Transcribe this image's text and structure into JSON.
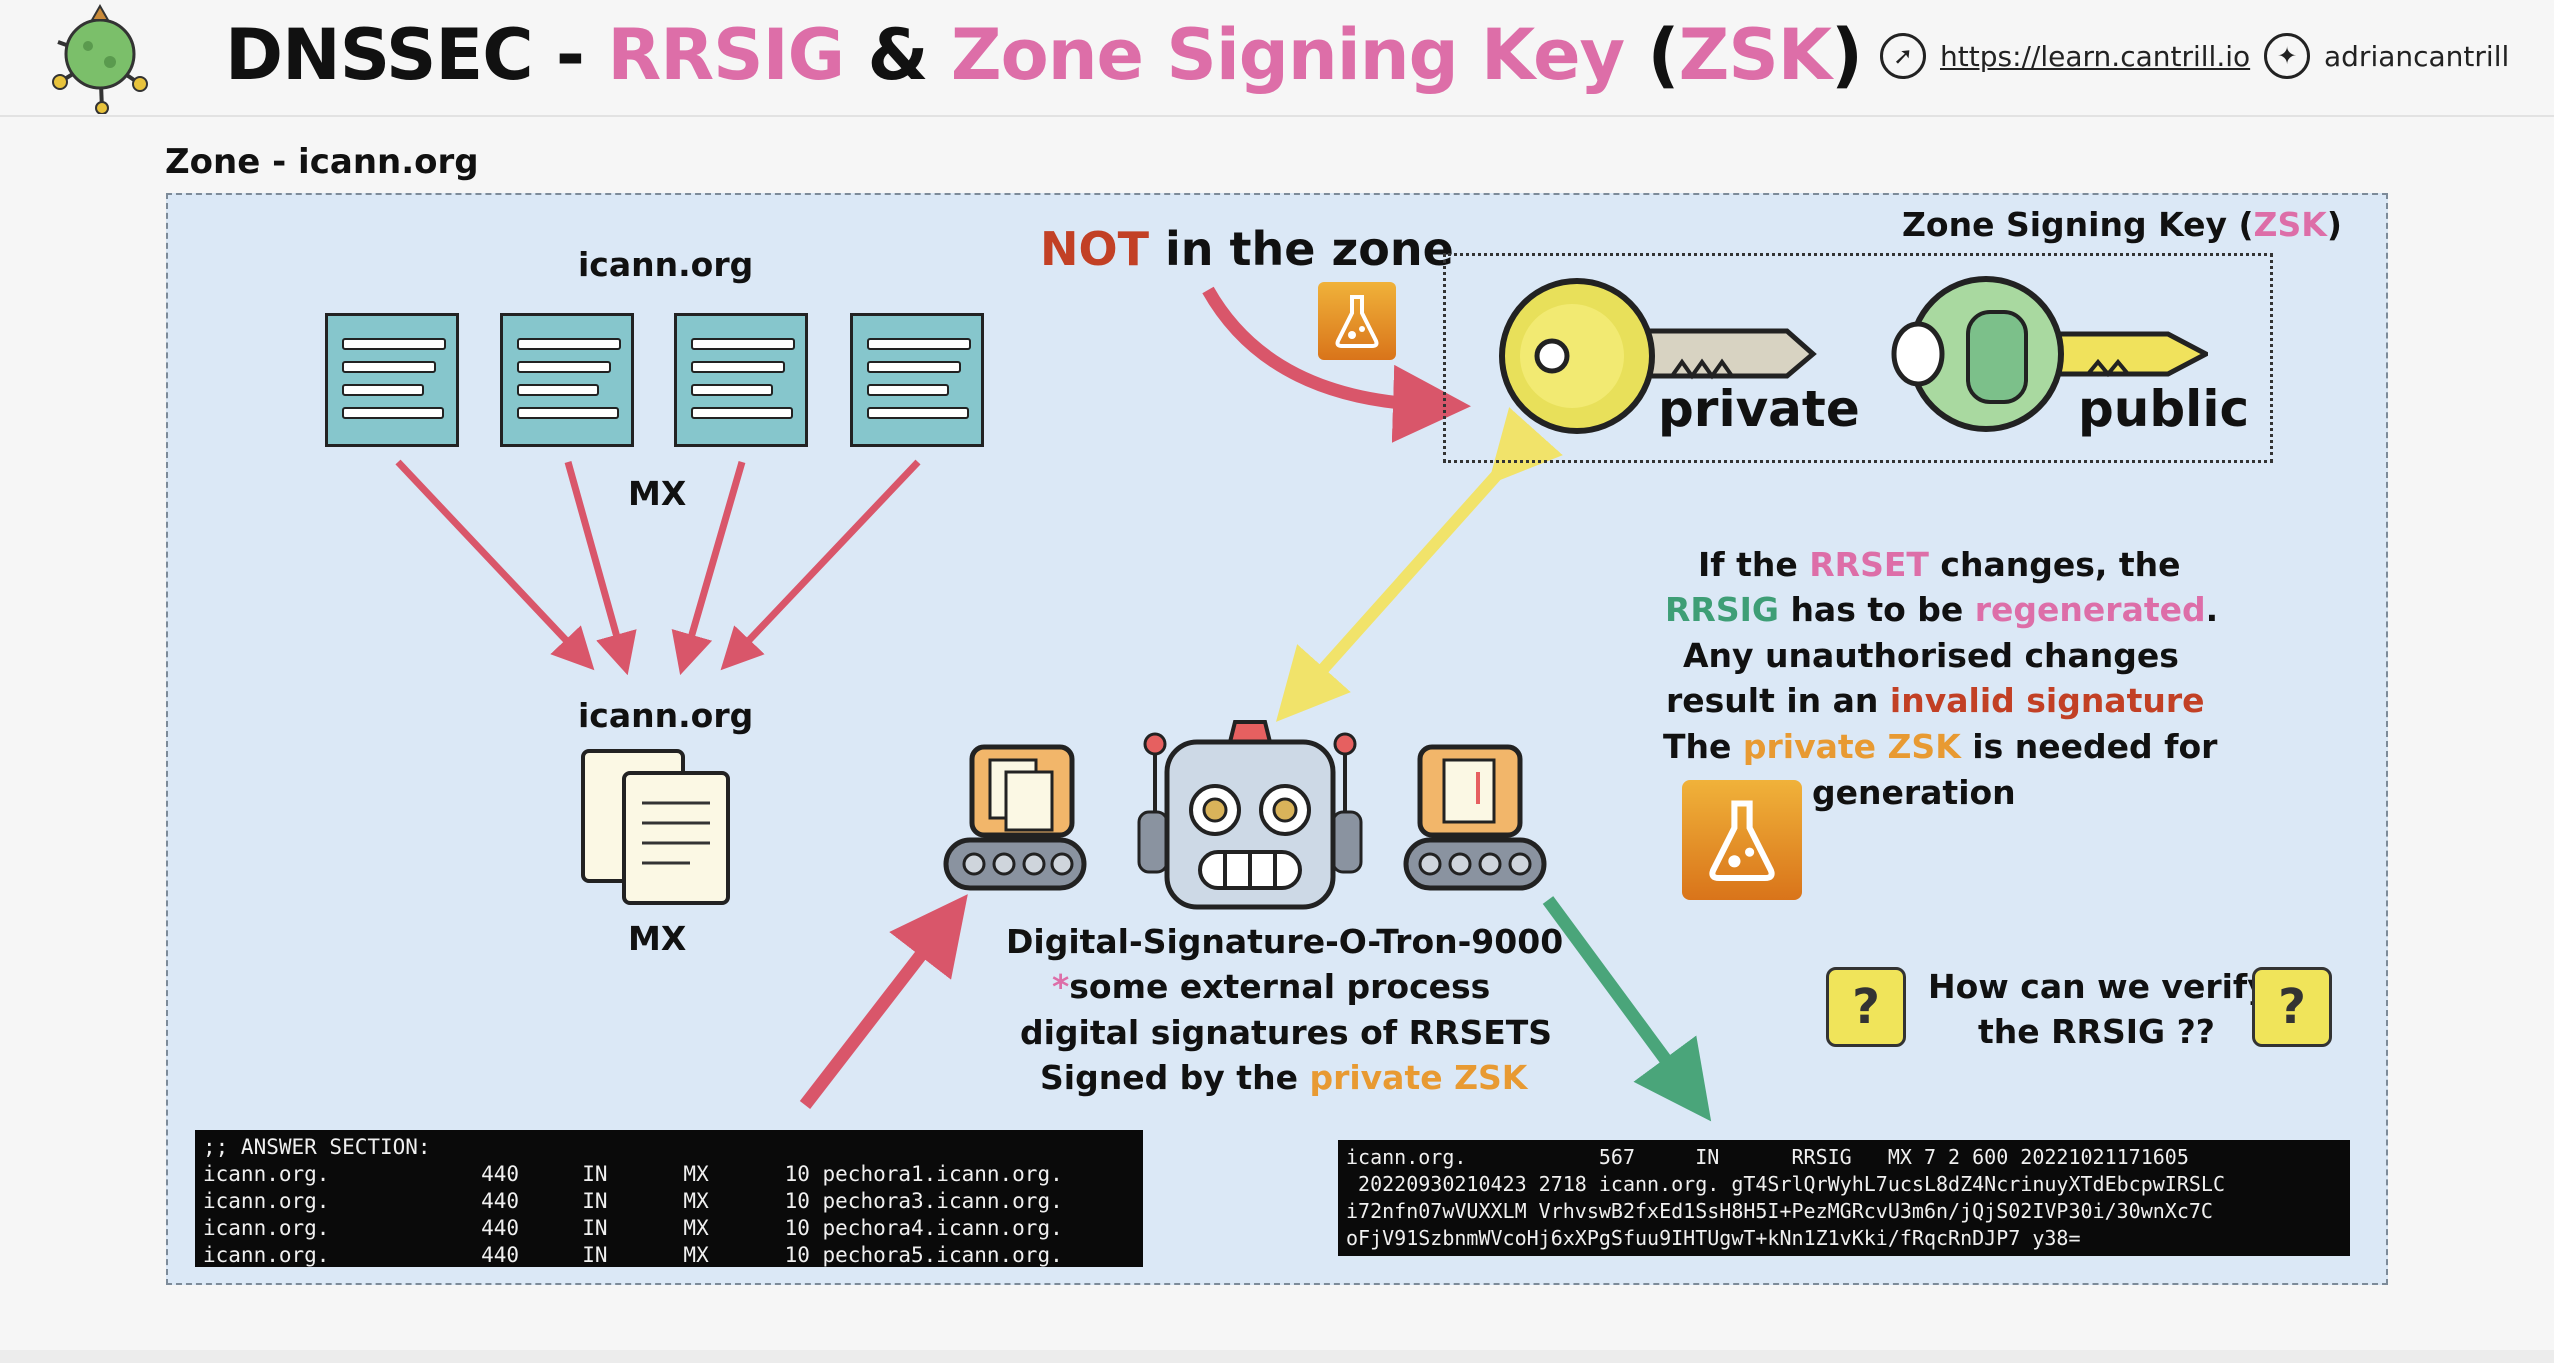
{
  "header": {
    "title_parts": [
      "DNSSEC - ",
      "RRSIG",
      " & ",
      "Zone Signing Key",
      " (",
      "ZSK",
      ")"
    ],
    "link_url": "https://learn.cantrill.io",
    "twitter": "adriancantrill",
    "compass_icon": "compass-icon",
    "twitter_icon": "twitter-bird-icon"
  },
  "zone": {
    "label": "Zone - icann.org",
    "rrset_top_label": "icann.org",
    "rrset_top_type": "MX",
    "rrset_bottom_label": "icann.org",
    "rrset_bottom_type": "MX"
  },
  "zsk": {
    "title_parts": [
      "Zone Signing Key (",
      "ZSK",
      ")"
    ],
    "not_in_zone_parts": [
      "NOT",
      " in the zone"
    ],
    "private_label": "private",
    "public_label": "public"
  },
  "info": {
    "line1": [
      "If the ",
      "RRSET",
      " changes, the"
    ],
    "line2": [
      "RRSIG",
      " has to be ",
      "regenerated",
      "."
    ],
    "line3": "Any unauthorised changes",
    "line4": [
      "result in an ",
      "invalid signature"
    ],
    "line5": [
      "The ",
      "private ZSK",
      " is needed for"
    ],
    "line6": "generation"
  },
  "robot": {
    "name": "Digital-Signature-O-Tron-9000",
    "line2": [
      "*",
      "some external process"
    ],
    "line3": "digital signatures of RRSETS",
    "line4": [
      "Signed by the ",
      "private ZSK"
    ]
  },
  "question": {
    "line1": "How can we verify",
    "line2": "the RRSIG ??",
    "icon_glyph": "?"
  },
  "answer_terminal": {
    "lines": [
      ";; ANSWER SECTION:",
      "icann.org.            440     IN      MX      10 pechora1.icann.org.",
      "icann.org.            440     IN      MX      10 pechora3.icann.org.",
      "icann.org.            440     IN      MX      10 pechora4.icann.org.",
      "icann.org.            440     IN      MX      10 pechora5.icann.org."
    ]
  },
  "rrsig_terminal": {
    "lines": [
      "icann.org.           567     IN      RRSIG   MX 7 2 600 20221021171605",
      " 20220930210423 2718 icann.org. gT4SrlQrWyhL7ucsL8dZ4NcrinuyXTdEbcpwIRSLC",
      "i72nfn07wVUXXLM VrhvswB2fxEd1SsH8H5I+PezMGRcvU3m6n/jQjS02IVP30i/30wnXc7C",
      "oFjV91SzbnmWVcoHj6xXPgSfuu9IHTUgwT+kNn1Z1vKki/fRqcRnDJP7 y38="
    ]
  },
  "colors": {
    "pink": "#dd6ea8",
    "green": "#3e9e76",
    "orange": "#e89a32",
    "red": "#c24025",
    "arrow_red": "#d9566a",
    "arrow_yellow": "#f1e36a",
    "arrow_green": "#4aa57a",
    "zone_bg": "#dbe8f6",
    "doc_teal": "#86c6cc"
  }
}
